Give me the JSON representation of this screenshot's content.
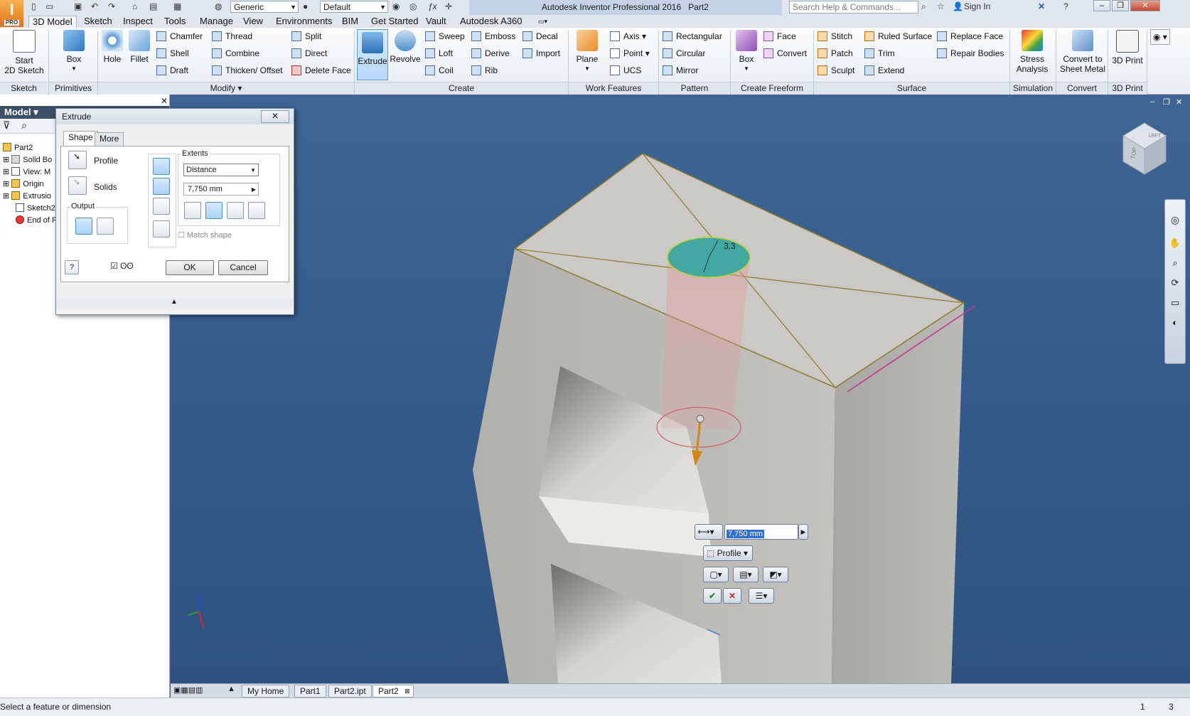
{
  "title": {
    "app": "Autodesk Inventor Professional 2016",
    "document": "Part2",
    "material_combo": "Generic",
    "appearance_combo": "Default",
    "search_placeholder": "Search Help & Commands...",
    "sign_in": "Sign In",
    "app_badge": "PRO"
  },
  "tabs": [
    "3D Model",
    "Sketch",
    "Inspect",
    "Tools",
    "Manage",
    "View",
    "Environments",
    "BIM",
    "Get Started",
    "Vault",
    "Autodesk A360"
  ],
  "ribbon": {
    "sketch": {
      "start": "Start",
      "start2": "2D Sketch",
      "panel": "Sketch"
    },
    "primitives": {
      "box": "Box",
      "panel": "Primitives"
    },
    "modify": {
      "hole": "Hole",
      "fillet": "Fillet",
      "chamfer": "Chamfer",
      "shell": "Shell",
      "draft": "Draft",
      "thread": "Thread",
      "combine": "Combine",
      "thicken": "Thicken/ Offset",
      "split": "Split",
      "direct": "Direct",
      "delete_face": "Delete Face",
      "panel": "Modify ▾"
    },
    "create": {
      "extrude": "Extrude",
      "revolve": "Revolve",
      "sweep": "Sweep",
      "loft": "Loft",
      "coil": "Coil",
      "emboss": "Emboss",
      "derive": "Derive",
      "rib": "Rib",
      "decal": "Decal",
      "import": "Import",
      "panel": "Create"
    },
    "work_features": {
      "plane": "Plane",
      "axis": "Axis",
      "point": "Point",
      "ucs": "UCS",
      "panel": "Work Features"
    },
    "pattern": {
      "rectangular": "Rectangular",
      "circular": "Circular",
      "mirror": "Mirror",
      "panel": "Pattern"
    },
    "freeform": {
      "box": "Box",
      "face": "Face",
      "convert": "Convert",
      "panel": "Create Freeform"
    },
    "surface": {
      "stitch": "Stitch",
      "patch": "Patch",
      "sculpt": "Sculpt",
      "ruled": "Ruled Surface",
      "trim": "Trim",
      "extend": "Extend",
      "replace": "Replace Face",
      "repair": "Repair Bodies",
      "panel": "Surface"
    },
    "simulation": {
      "stress": "Stress",
      "stress2": "Analysis",
      "panel": "Simulation"
    },
    "convert": {
      "sheet": "Convert to",
      "sheet2": "Sheet Metal",
      "panel": "Convert"
    },
    "print": {
      "print": "3D Print",
      "panel": "3D Print"
    }
  },
  "browser": {
    "title": "Model ▾",
    "items": [
      "Part2",
      "Solid Bo",
      "View: M",
      "Origin",
      "Extrusio",
      "Sketch2",
      "End of P"
    ]
  },
  "dialog": {
    "title": "Extrude",
    "tab_shape": "Shape",
    "tab_more": "More",
    "profile": "Profile",
    "solids": "Solids",
    "output": "Output",
    "extents": "Extents",
    "extents_value": "Distance",
    "distance": "7,750 mm",
    "match_shape": "Match shape",
    "ok": "OK",
    "cancel": "Cancel"
  },
  "viewport": {
    "dimension_label": "3.3",
    "mini_value": "7,750 mm",
    "mini_profile": "Profile",
    "viewcube_label": "TOP",
    "viewcube_label2": "LEFT"
  },
  "doc_tabs": [
    "My Home",
    "Part1",
    "Part2.ipt",
    "Part2"
  ],
  "status": {
    "message": "Select a feature or dimension",
    "count1": "1",
    "count2": "3"
  },
  "colors": {
    "viewport_bg": "#3e6592",
    "body_face": "#cac8c4",
    "sketch_edge": "#8a7d2c",
    "profile_fill": "#3ea8a0",
    "extrude_preview": "#e08080",
    "accent": "#3a87d6"
  }
}
